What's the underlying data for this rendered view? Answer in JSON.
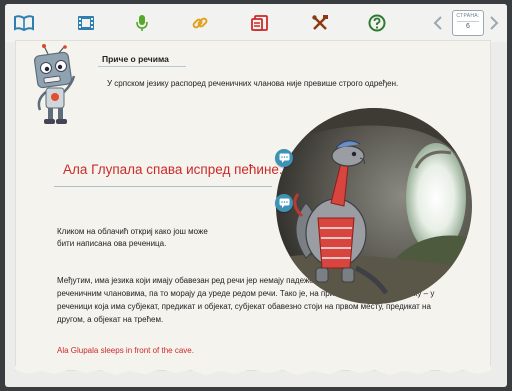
{
  "toolbar": {
    "icons": [
      "book-icon",
      "film-icon",
      "microphone-icon",
      "link-icon",
      "quiz-icon",
      "tools-icon",
      "help-icon"
    ],
    "pager_label": "СТРАНА:",
    "page_number": "6"
  },
  "colors": {
    "accent_red": "#cc2a2a",
    "accent_blue": "#2e7fb0",
    "icon_green": "#55a82a"
  },
  "content": {
    "title": "Приче о речима",
    "intro": "У српском језику распоред реченичних чланова није превише строго одређен.",
    "headline": "Ала Глупала спава испред пећине.",
    "click_instruction": "Кликом на облачић откриј како још може бити написана ова реченица.",
    "paragraph": "Међутим, има језика који имају обавезан ред речи јер немају падеже да изразе односе међу реченичним члановима, па то морају да уреде редом речи. Тако је, на пример, у енглеском језику – у реченици која има субјекат, предикат и објекат, субјекат обавезно стоји на првом месту, предикат на другом, а објекат на трећем.",
    "english_sentence": "Ala Glupala sleeps in front of the cave."
  }
}
